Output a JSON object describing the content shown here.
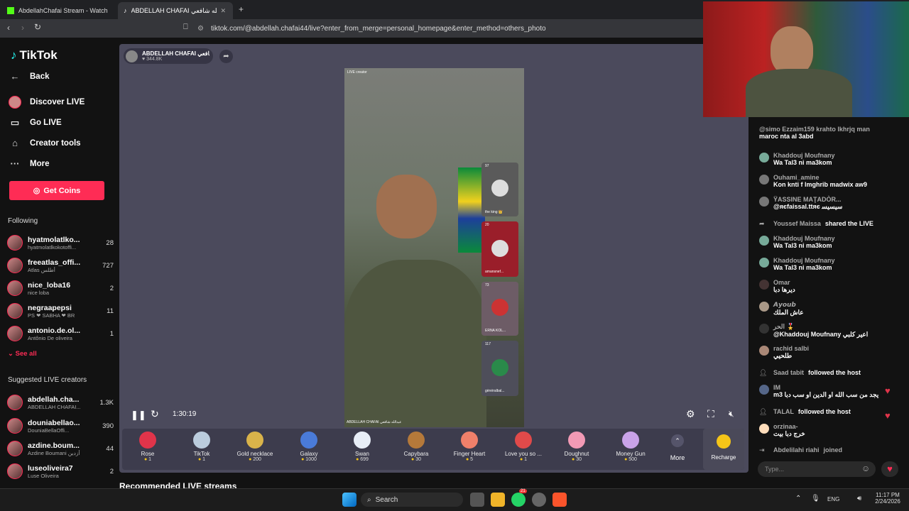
{
  "browser": {
    "tabs": [
      {
        "label": "AbdellahChafai Stream - Watch Live",
        "icon": "kick-icon"
      },
      {
        "label": "ABDELLAH CHAFAI عبدالله شافعي",
        "icon": "tiktok-icon"
      }
    ],
    "url": "tiktok.com/@abdellah.chafai44/live?enter_from_merge=personal_homepage&enter_method=others_photo"
  },
  "sidebar": {
    "logo": "TikTok",
    "back": "Back",
    "nav": [
      "Discover LIVE",
      "Go LIVE",
      "Creator tools",
      "More"
    ],
    "coins": "Get Coins",
    "following_title": "Following",
    "following": [
      {
        "name": "hyatmolatlko...",
        "sub": "hyatmolatlkokotoffi...",
        "count": "28"
      },
      {
        "name": "freeatlas_offi...",
        "sub": "Atlas أطلس",
        "count": "727"
      },
      {
        "name": "nice_loba16",
        "sub": "nice loba",
        "count": "2"
      },
      {
        "name": "negraapepsi",
        "sub": "PS ❤ SABHA ❤ BR",
        "count": "11"
      },
      {
        "name": "antonio.de.ol...",
        "sub": "Antônio De oliveira",
        "count": "1"
      }
    ],
    "see_all": "See all",
    "suggested_title": "Suggested LIVE creators",
    "suggested": [
      {
        "name": "abdellah.cha...",
        "sub": "ABDELLAH CHAFAI...",
        "count": "1.3K"
      },
      {
        "name": "douniabellao...",
        "sub": "DouniaBellaOffi...",
        "count": "390"
      },
      {
        "name": "azdine.boum...",
        "sub": "Azdine Boumani أزدين",
        "count": "44"
      },
      {
        "name": "luseoliveira7",
        "sub": "Luse Oliveira",
        "count": "2"
      }
    ]
  },
  "player": {
    "host_name": "ABDELLAH CHAFAI عبدالله شافعي",
    "likes": "♥ 344.8K",
    "live_tag": "LIVE creator",
    "caption": "ABDELLAH CHAFAI عبدالله شافعي",
    "time": "1:30:19",
    "cohosts": [
      {
        "count": "97",
        "name": "the king 👑"
      },
      {
        "count": "20",
        "name": "amansnef..."
      },
      {
        "count": "73",
        "name": "ERNA KOL..."
      },
      {
        "count": "117",
        "name": "gènéralbal..."
      }
    ]
  },
  "gifts": [
    {
      "name": "Rose",
      "price": "1",
      "color": "#e0344a"
    },
    {
      "name": "TikTok",
      "price": "1",
      "color": "#bcd"
    },
    {
      "name": "Gold necklace",
      "price": "200",
      "color": "#d9b34a"
    },
    {
      "name": "Galaxy",
      "price": "1000",
      "color": "#4a7bd9"
    },
    {
      "name": "Swan",
      "price": "699",
      "color": "#e8eef7"
    },
    {
      "name": "Capybara",
      "price": "30",
      "color": "#b5793a"
    },
    {
      "name": "Finger Heart",
      "price": "5",
      "color": "#f0806a"
    },
    {
      "name": "Love you so ...",
      "price": "1",
      "color": "#e04a4a"
    },
    {
      "name": "Doughnut",
      "price": "30",
      "color": "#f29ab5"
    },
    {
      "name": "Money Gun",
      "price": "500",
      "color": "#c9a3e8"
    }
  ],
  "gift_more": "More",
  "recharge": "Recharge",
  "recommended": "Recommended LIVE streams",
  "chat": {
    "messages": [
      {
        "name": "@simo Ezzaim159 krahto lkhrjq man",
        "text": "maroc nta al 3abd"
      },
      {
        "name": "Khaddouj Moufnany",
        "text": "Wa Tal3 ni ma3kom"
      },
      {
        "name": "Ouhami_amine",
        "text": "Kon knti f lmghrib madwix aw9"
      },
      {
        "name": "ŸASSINE MAŢADÒR...",
        "text": "@яєfaissal.ttяє ﺳﻴﺴﻴﺴ"
      },
      {
        "name": "Youssef Maissa",
        "text": "shared the LIVE"
      },
      {
        "name": "Khaddouj Moufnany",
        "text": "Wa Tal3 ni ma3kom"
      },
      {
        "name": "Khaddouj Moufnany",
        "text": "Wa Tal3 ni ma3kom"
      },
      {
        "name": "Omar",
        "text": "ديرها دبا"
      },
      {
        "name": "𝘼𝙮𝙤𝙪𝙗",
        "text": "عاش الملك"
      },
      {
        "name": "الحر 🎖️",
        "text": "@Khaddouj Moufnany اعير كلبي"
      },
      {
        "name": "rachid salbi",
        "text": "طلحيي"
      },
      {
        "name": "Saad tabit",
        "text": "followed the host"
      },
      {
        "name": "IM",
        "text": "m3 يجد من سب الله او الدين او سب دبا"
      },
      {
        "name": "TALAL",
        "text": "followed the host"
      },
      {
        "name": "orzinaa-",
        "text": "خرج دبا بيت"
      },
      {
        "name": "Abdelilahi riahi",
        "text": "joined"
      }
    ],
    "placeholder": "Type..."
  },
  "taskbar": {
    "search": "Search",
    "lang": "ENG",
    "time": "11:17 PM",
    "date": "2/24/2026",
    "badge": "21"
  }
}
